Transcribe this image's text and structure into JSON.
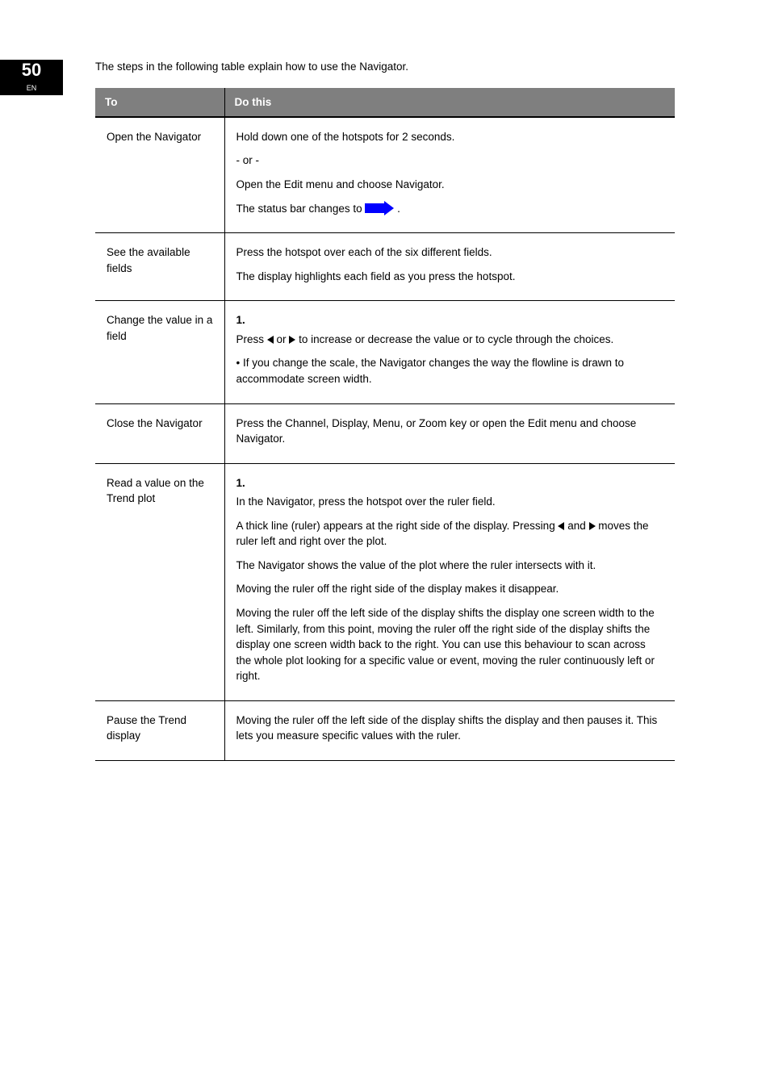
{
  "header": {
    "page_num": "50",
    "section": "EN"
  },
  "intro_text": "The steps in the following table explain how to use the Navigator.",
  "table": {
    "col0_header": "To",
    "col1_header": "Do this",
    "rows": [
      {
        "c0": "Open the Navigator",
        "c1": {
          "paras": [
            "Hold down one of the hotspots for 2 seconds.",
            "- or -",
            "Open the Edit menu and choose Navigator."
          ],
          "trailing_icon_para_prefix": "The status bar changes to   ",
          "trailing_icon_para_suffix": "   ."
        }
      },
      {
        "c0": "See the available fields",
        "c1": {
          "p1": "Press the hotspot over each of the six different fields.",
          "p2": "The display highlights each field as you press the hotspot."
        }
      },
      {
        "c0": "Change the value in a field",
        "c1": {
          "step": "1.",
          "l1_pre": "Press ",
          "l1_mid": " or ",
          "l1_post": " to increase or decrease the value or to cycle through the choices.",
          "l2": "•  If you change the scale, the Navigator changes the way the flowline is drawn to accommodate screen width."
        }
      },
      {
        "c0": "Close the Navigator",
        "c1": "Press the Channel, Display, Menu, or Zoom key or open the Edit menu and choose Navigator."
      },
      {
        "c0": "Read a value on the Trend plot",
        "c1": {
          "step": "1.",
          "step_text": "In the Navigator, press the hotspot over the ruler field.",
          "l2_pre": "A thick line (ruler) appears at the right side of the display. Pressing ",
          "l2_mid": " and ",
          "l2_post": " moves the ruler left and right over the plot.",
          "l3": "The Navigator shows the value of the plot where the ruler intersects with it.",
          "l4": "Moving the ruler off the right side of the display makes it disappear.",
          "l5": "Moving the ruler off the left side of the display shifts the display one screen width to the left. Similarly, from this point, moving the ruler off the right side of the display shifts the display one screen width back to the right. You can use this behaviour to scan across the whole plot looking for a specific value or event, moving the ruler continuously left or right."
        }
      },
      {
        "c0": "Pause the Trend display",
        "c1": "Moving the ruler off the left side of the display shifts the display and then pauses it. This lets you measure specific values with the ruler."
      }
    ]
  }
}
